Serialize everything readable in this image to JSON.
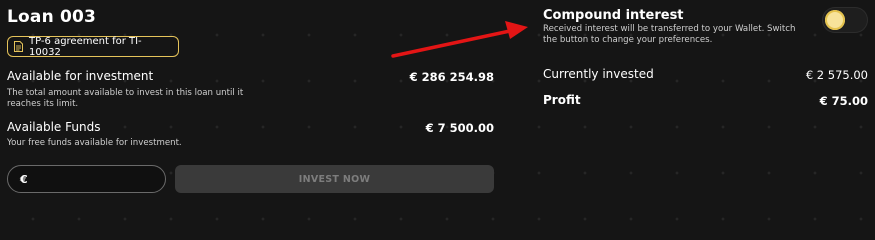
{
  "loan": {
    "title": "Loan 003",
    "agreement": "TP-6 agreement for TI-10032"
  },
  "available_investment": {
    "label": "Available for investment",
    "desc": "The total amount available to invest in this loan until it reaches its limit.",
    "value": "€ 286 254.98"
  },
  "available_funds": {
    "label": "Available Funds",
    "desc": "Your free funds available for investment.",
    "value": "€ 7 500.00"
  },
  "invest": {
    "currency_symbol": "€",
    "input_value": "",
    "button_label": "INVEST NOW"
  },
  "compound": {
    "title": "Compound interest",
    "desc": "Received interest will be transferred to your Wallet. Switch the button to change your preferences."
  },
  "currently_invested": {
    "label": "Currently invested",
    "value": "€ 2 575.00"
  },
  "profit": {
    "label": "Profit",
    "value": "€ 75.00"
  },
  "colors": {
    "background": "#151515",
    "accent": "#e5c35a",
    "annotation_arrow": "#e31515",
    "disabled_button": "#3a3a3a"
  }
}
